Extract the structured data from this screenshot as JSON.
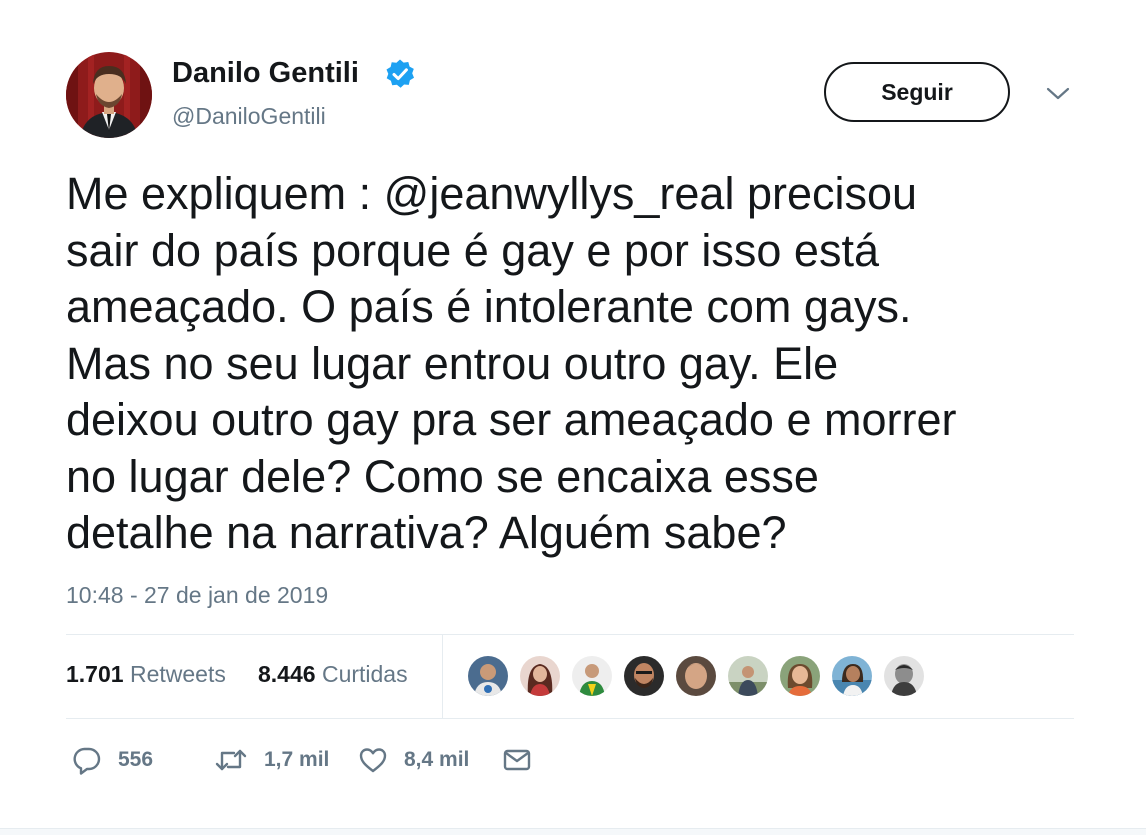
{
  "author": {
    "name": "Danilo Gentili",
    "handle": "@DaniloGentili",
    "verified": true,
    "avatar_icon": "profile-photo"
  },
  "follow_button": {
    "label": "Seguir"
  },
  "menu": {
    "icon": "chevron-down-icon"
  },
  "tweet": {
    "lines": [
      "Me expliquem : @jeanwyllys_real precisou",
      "sair do país porque é gay e por isso está",
      "ameaçado. O país é intolerante com gays.",
      "Mas no seu lugar entrou outro gay. Ele",
      "deixou outro gay pra ser ameaçado e morrer",
      "no lugar dele? Como se encaixa esse",
      "detalhe na narrativa? Alguém sabe?"
    ],
    "timestamp": "10:48 - 27 de jan de 2019"
  },
  "stats": {
    "retweets_count": "1.701",
    "retweets_label": "Retweets",
    "likes_count": "8.446",
    "likes_label": "Curtidas"
  },
  "actions": {
    "reply_count": "556",
    "retweet_count": "1,7 mil",
    "like_count": "8,4 mil"
  },
  "colors": {
    "text": "#14171a",
    "secondary": "#657786",
    "verified": "#1da1f2",
    "divider": "#e6ecf0"
  }
}
